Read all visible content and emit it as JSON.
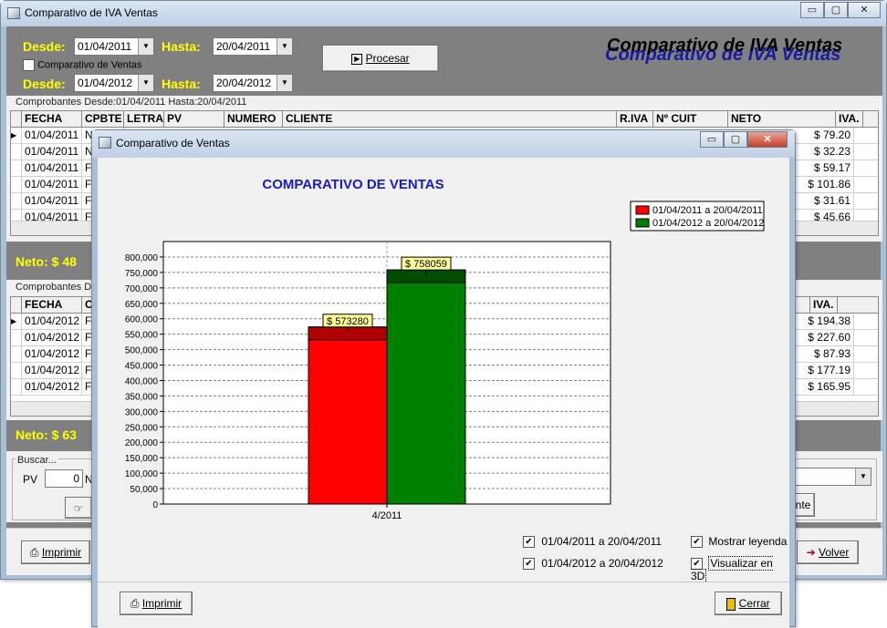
{
  "main_window": {
    "title": "Comparativo de IVA Ventas",
    "window_buttons": {
      "minimize": "▭",
      "maximize": "▢",
      "close": "✕"
    },
    "desde_label": "Desde:",
    "hasta_label": "Hasta:",
    "desde1": "01/04/2011",
    "hasta1": "20/04/2011",
    "desde2": "01/04/2012",
    "hasta2": "20/04/2012",
    "comparativo_checkbox_label": "Comparativo de Ventas",
    "procesar_label": "Procesar",
    "banner": "Comparativo de IVA Ventas",
    "section1_title": "Comprobantes Desde:01/04/2011 Hasta:20/04/2011",
    "section2_title": "Comprobantes De",
    "grid1": {
      "columns": [
        "FECHA",
        "CPBTE",
        "LETRA",
        "PV",
        "NUMERO",
        "CLIENTE",
        "R.IVA",
        "Nº CUIT",
        "NETO",
        "IVA."
      ],
      "rows": [
        {
          "fecha": "01/04/2011",
          "cpbte": "N",
          "neto": "$ 79.20"
        },
        {
          "fecha": "01/04/2011",
          "cpbte": "N",
          "neto": "$ 32.23"
        },
        {
          "fecha": "01/04/2011",
          "cpbte": "F",
          "neto": "$ 59.17"
        },
        {
          "fecha": "01/04/2011",
          "cpbte": "F",
          "neto": "$ 101.86"
        },
        {
          "fecha": "01/04/2011",
          "cpbte": "F",
          "neto": "$ 31.61"
        },
        {
          "fecha": "01/04/2011",
          "cpbte": "F",
          "neto": "$ 45.66"
        }
      ]
    },
    "neto1": "Neto:  $ 48",
    "grid2": {
      "columns": [
        "FECHA",
        "C",
        "IVA."
      ],
      "rows": [
        {
          "fecha": "01/04/2012",
          "cpbte": "F",
          "neto": "$ 194.38"
        },
        {
          "fecha": "01/04/2012",
          "cpbte": "F",
          "neto": "$ 227.60"
        },
        {
          "fecha": "01/04/2012",
          "cpbte": "F",
          "neto": "$ 87.93"
        },
        {
          "fecha": "01/04/2012",
          "cpbte": "F",
          "neto": "$ 177.19"
        },
        {
          "fecha": "01/04/2012",
          "cpbte": "F",
          "neto": "$ 165.95"
        }
      ]
    },
    "neto2": "Neto:  $ 63",
    "buscar_title": "Buscar...",
    "pv_label": "PV",
    "pv_value": "0",
    "n_label": "N",
    "nte_label": "nte",
    "imprimir_label": "Imprimir",
    "volver_label": "Volver"
  },
  "dialog": {
    "title": "Comparativo de Ventas",
    "window_buttons": {
      "minimize": "▭",
      "maximize": "▢",
      "close": "✕"
    },
    "show_legend_label": "Mostrar leyenda",
    "show_legend_checked": true,
    "view_3d_label": "Visualizar en 3D",
    "view_3d_checked": true,
    "series1_check_label": "01/04/2011 a 20/04/2011",
    "series2_check_label": "01/04/2012 a 20/04/2012",
    "imprimir_label": "Imprimir",
    "cerrar_label": "Cerrar"
  },
  "chart_data": {
    "type": "bar",
    "title": "COMPARATIVO DE VENTAS",
    "categories": [
      "4/2011"
    ],
    "series": [
      {
        "name": "01/04/2011 a 20/04/2011",
        "values": [
          573280
        ],
        "label": "$ 573280",
        "color": "#ff0000"
      },
      {
        "name": "01/04/2012 a 20/04/2012",
        "values": [
          758059
        ],
        "label": "$ 758059",
        "color": "#008000"
      }
    ],
    "ylim": [
      0,
      850000
    ],
    "yticks": [
      0,
      50000,
      100000,
      150000,
      200000,
      250000,
      300000,
      350000,
      400000,
      450000,
      500000,
      550000,
      600000,
      650000,
      700000,
      750000,
      800000
    ],
    "ytick_labels": [
      "0",
      "50,000",
      "100,000",
      "150,000",
      "200,000",
      "250,000",
      "300,000",
      "350,000",
      "400,000",
      "450,000",
      "500,000",
      "550,000",
      "600,000",
      "650,000",
      "700,000",
      "750,000",
      "800,000"
    ],
    "grid": true,
    "legend": "top-right",
    "three_d": true
  },
  "colors": {
    "accent_yellow": "#ffff00",
    "banner_blue": "#1a1aa0",
    "title_blue": "#1a1ac8"
  }
}
